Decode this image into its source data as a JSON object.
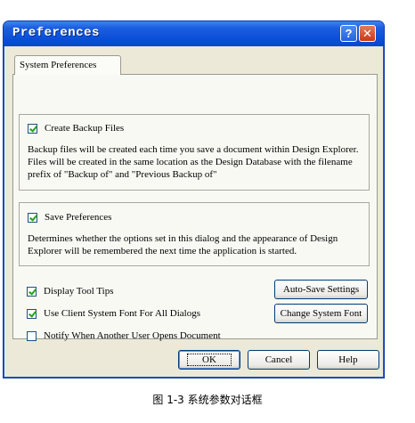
{
  "window": {
    "title": "Preferences",
    "help_glyph": "?",
    "close_glyph": "✕"
  },
  "tabs": [
    {
      "label": "System Preferences",
      "active": true
    }
  ],
  "backup": {
    "checkbox_label": "Create Backup Files",
    "checked": true,
    "description": "Backup files will be created each time you save a document within Design Explorer. Files will be created in the same location as the Design Database with the filename prefix of \"Backup of\" and \"Previous Backup of\""
  },
  "save_prefs": {
    "checkbox_label": "Save Preferences",
    "checked": true,
    "description": "Determines whether the options set in this dialog and the appearance of Design Explorer will be remembered the next time the application is started."
  },
  "options": [
    {
      "label": "Display Tool Tips",
      "checked": true
    },
    {
      "label": "Use Client System Font For All Dialogs",
      "checked": true
    },
    {
      "label": "Notify When Another User Opens Document",
      "checked": false
    }
  ],
  "side_buttons": {
    "autosave": "Auto-Save Settings",
    "change_font": "Change System Font"
  },
  "footer_buttons": {
    "ok": "OK",
    "cancel": "Cancel",
    "help": "Help"
  },
  "caption": "图 1-3  系统参数对话框"
}
